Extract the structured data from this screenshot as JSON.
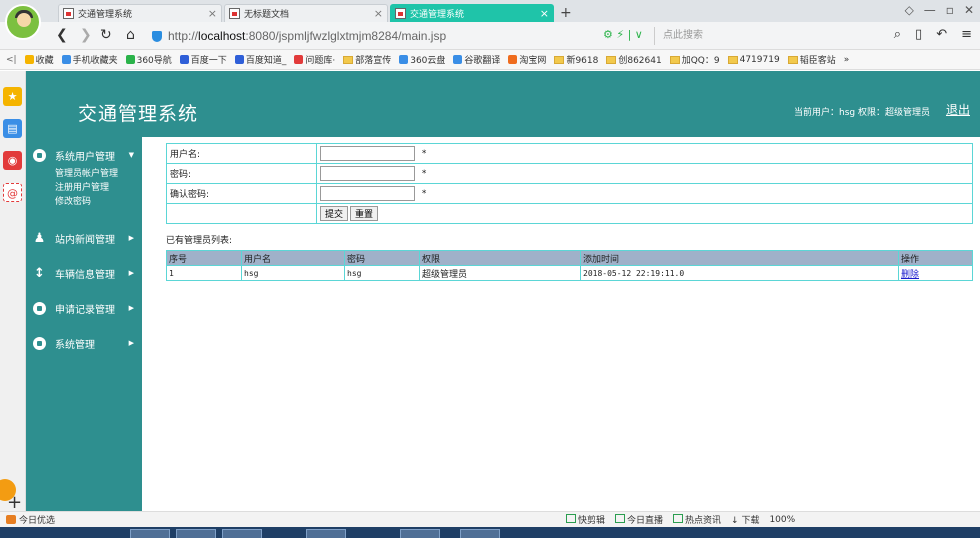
{
  "browser": {
    "tabs": [
      {
        "label": "交通管理系统",
        "active": false
      },
      {
        "label": "无标题文档",
        "active": false
      },
      {
        "label": "交通管理系统",
        "active": true
      }
    ],
    "new_tab": "+",
    "window_controls": [
      "◇",
      "—",
      "▫",
      "✕"
    ],
    "url": {
      "scheme": "http://",
      "host": "localhost",
      "rest": ":8080/jspmljfwzlglxtmjm8284/main.jsp"
    },
    "url_extra": "⚙ ⚡ | ∨",
    "search_placeholder": "点此搜索",
    "bookmarks": [
      {
        "label": "收藏",
        "icon": "star-icon",
        "color": "#f5b400"
      },
      {
        "label": "手机收藏夹",
        "icon": "phone-icon",
        "color": "#3a8ee6"
      },
      {
        "label": "360导航",
        "icon": "nav360-icon",
        "color": "#2bb34a"
      },
      {
        "label": "百度一下",
        "icon": "baidu-icon",
        "color": "#2f5fd8"
      },
      {
        "label": "百度知道_",
        "icon": "baidu-icon",
        "color": "#2f5fd8"
      },
      {
        "label": "问题库·",
        "icon": "weibo-icon",
        "color": "#e23b3b"
      },
      {
        "label": "部落宣传",
        "icon": "folder-icon",
        "color": "#f2c94c"
      },
      {
        "label": "360云盘",
        "icon": "cloud-icon",
        "color": "#3a8ee6"
      },
      {
        "label": "谷歌翻译",
        "icon": "translate-icon",
        "color": "#3a8ee6"
      },
      {
        "label": "淘宝网",
        "icon": "taobao-icon",
        "color": "#ef6c1e"
      },
      {
        "label": "新9618",
        "icon": "folder-icon",
        "color": "#f2c94c"
      },
      {
        "label": "创862641",
        "icon": "folder-icon",
        "color": "#f2c94c"
      },
      {
        "label": "加QQ：9",
        "icon": "folder-icon",
        "color": "#f2c94c"
      },
      {
        "label": "4719719",
        "icon": "folder-icon",
        "color": "#f2c94c"
      },
      {
        "label": "韬臣客站",
        "icon": "folder-icon",
        "color": "#f2c94c"
      },
      {
        "label": "»",
        "icon": "more-icon",
        "color": "#666666"
      }
    ]
  },
  "app": {
    "title": "交通管理系统",
    "user_info": "当前用户：hsg  权限：超级管理员",
    "logout_label": "退出",
    "theme_color": "#2e8f8f"
  },
  "sidebar": {
    "menus": [
      {
        "label": "系统用户管理",
        "arrow": "▼",
        "icon": "user-icon",
        "expanded": true,
        "items": [
          "管理员帐户管理",
          "注册用户管理",
          "修改密码"
        ]
      },
      {
        "label": "站内新闻管理",
        "arrow": "▶",
        "icon": "news-icon"
      },
      {
        "label": "车辆信息管理",
        "arrow": "▶",
        "icon": "vehicle-icon"
      },
      {
        "label": "申请记录管理",
        "arrow": "▶",
        "icon": "app-icon"
      },
      {
        "label": "系统管理",
        "arrow": "▶",
        "icon": "settings-icon"
      }
    ]
  },
  "form": {
    "username_label": "用户名:",
    "password_label": "密码:",
    "confirm_label": "确认密码:",
    "required_mark": "*",
    "username_value": "",
    "password_value": "",
    "confirm_value": "",
    "submit_label": "提交",
    "reset_label": "重置"
  },
  "admin_list": {
    "caption": "已有管理员列表:",
    "headers": [
      "序号",
      "用户名",
      "密码",
      "权限",
      "添加时间",
      "操作"
    ],
    "rows": [
      {
        "index": "1",
        "username": "hsg",
        "password": "hsg",
        "role": "超级管理员",
        "added": "2018-05-12 22:19:11.0",
        "action": "删除"
      }
    ]
  },
  "statusbar": {
    "left": "今日优选",
    "items": [
      "快剪辑",
      "今日直播",
      "热点资讯",
      "↓ 下载",
      "100%"
    ]
  }
}
